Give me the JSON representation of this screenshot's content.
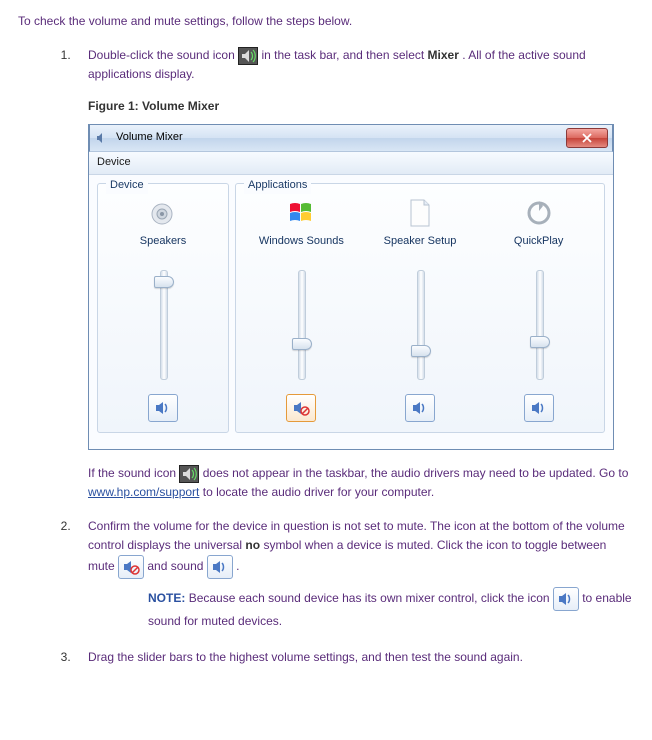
{
  "intro": "To check the volume and mute settings, follow the steps below.",
  "step1": {
    "text_before": "Double-click the sound icon ",
    "text_mid": " in the task bar, and then select ",
    "mixer": "Mixer",
    "text_after": " . All of the active sound applications display."
  },
  "figure_label": "Figure 1: Volume Mixer",
  "window": {
    "title": "Volume Mixer",
    "menu": "Device",
    "device_panel": "Device",
    "apps_panel": "Applications",
    "columns": [
      {
        "label": "Speakers",
        "slider": 5,
        "muted": false,
        "icon": "speaker"
      },
      {
        "label": "Windows Sounds",
        "slider": 62,
        "muted": true,
        "icon": "winflag"
      },
      {
        "label": "Speaker Setup",
        "slider": 68,
        "muted": false,
        "icon": "page"
      },
      {
        "label": "QuickPlay",
        "slider": 60,
        "muted": false,
        "icon": "refresh"
      }
    ]
  },
  "step1b": {
    "before": "If the sound icon ",
    "after": " does not appear in the taskbar, the audio drivers may need to be updated. Go to ",
    "link": "www.hp.com/support",
    "tail": " to locate the audio driver for your computer."
  },
  "step2": {
    "l1": "Confirm the volume for the device in question is not set to mute. The icon at the bottom of the volume control displays the universal ",
    "no": "no",
    "l2": " symbol when a device is muted. Click the icon to toggle between mute ",
    "and_sound": " and sound ",
    "period": " ."
  },
  "note": {
    "label": "NOTE:",
    "l1": " Because each sound device has its own mixer control, click the icon ",
    "l2": " to enable sound for muted devices."
  },
  "step3": "Drag the slider bars to the highest volume settings, and then test the sound again."
}
